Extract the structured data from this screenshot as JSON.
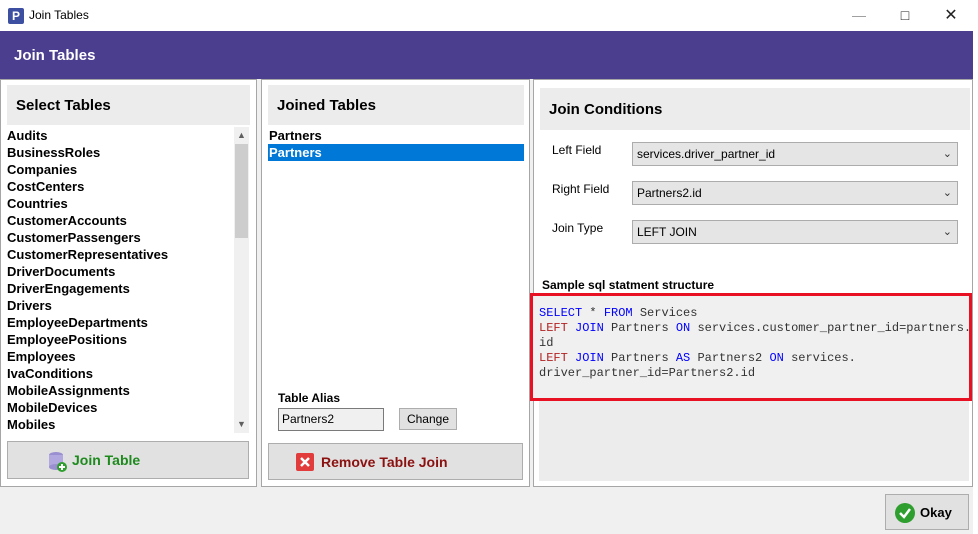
{
  "window": {
    "title": "Join Tables",
    "app_icon": "P",
    "minimize": "—",
    "maximize": "□",
    "close": "✕"
  },
  "header": {
    "title": "Join Tables"
  },
  "select_panel": {
    "title": "Select Tables",
    "tables": [
      "Audits",
      "BusinessRoles",
      "Companies",
      "CostCenters",
      "Countries",
      "CustomerAccounts",
      "CustomerPassengers",
      "CustomerRepresentatives",
      "DriverDocuments",
      "DriverEngagements",
      "Drivers",
      "EmployeeDepartments",
      "EmployeePositions",
      "Employees",
      "IvaConditions",
      "MobileAssignments",
      "MobileDevices",
      "Mobiles"
    ],
    "join_button": "Join Table"
  },
  "joined_panel": {
    "title": "Joined Tables",
    "items": [
      {
        "label": "Partners",
        "selected": false
      },
      {
        "label": "Partners",
        "selected": true
      }
    ],
    "alias_label": "Table Alias",
    "alias_value": "Partners2",
    "change_button": "Change",
    "remove_button": "Remove Table Join"
  },
  "conditions_panel": {
    "title": "Join Conditions",
    "left_field_label": "Left Field",
    "left_field_value": "services.driver_partner_id",
    "right_field_label": "Right Field",
    "right_field_value": "Partners2.id",
    "join_type_label": "Join Type",
    "join_type_value": "LEFT JOIN",
    "sample_label": "Sample sql statment structure",
    "sql": {
      "l1a": "SELECT",
      "l1b": " * ",
      "l1c": "FROM",
      "l1d": " Services",
      "l2a": "LEFT",
      "l2b": " ",
      "l2c": "JOIN",
      "l2d": " Partners ",
      "l2e": "ON",
      "l2f": " services.customer_partner_id=partners.",
      "l3": "id",
      "l4a": "LEFT",
      "l4b": " ",
      "l4c": "JOIN",
      "l4d": " Partners ",
      "l4e": "AS",
      "l4f": " Partners2 ",
      "l4g": "ON",
      "l4h": " services.",
      "l5": "driver_partner_id=Partners2.id"
    }
  },
  "footer": {
    "okay_button": "Okay"
  },
  "colors": {
    "header": "#4b3e8e",
    "selection": "#0078d7",
    "join_green": "#1e8a1e",
    "remove_red": "#8b1010",
    "highlight_border": "#e81123"
  }
}
